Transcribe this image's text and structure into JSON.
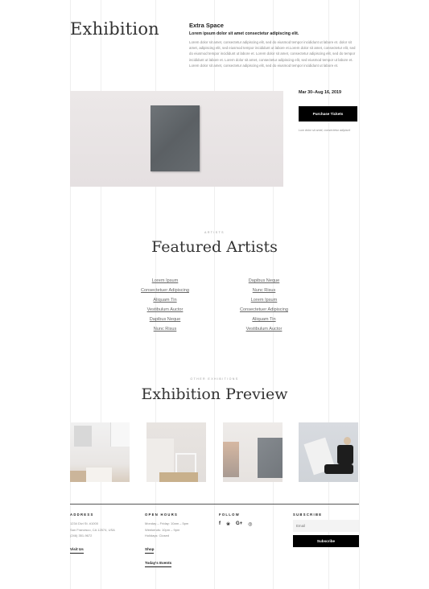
{
  "exhibition": {
    "title": "Exhibition",
    "space_name": "Extra Space",
    "subheading": "Lorem ipsum dolor sit amet consectetur adipiscing elit.",
    "paragraph": "Lorem dolor sit amet, consectetur adipiscing elit, sed do eiusmod tempor incididunt ut labore et. dolor sit amet, adipiscing elit, sed eiusmod tempor incididunt ut labore et.Lorem dolor sit amet, consectetur elit, sed do eiusmod tempor incididunt ut labore et. Lorem dolor sit amet, consectetur adipiscing elit, sed do tempor incididunt ut labore et. Lorem dolor sit amet, consectetur adipiscing elit, sed eiusmod tempor ut labore et. Lorem dolor sit amet, consectetur adipiscing elit, sed do eiusmod tempor incididunt ut labore et.",
    "date": "Mar 30–Aug 16, 2019",
    "tickets_label": "Purchase Tickets",
    "note": "Lum dolor sit amet, consectetur adipiscit"
  },
  "artists": {
    "eyebrow": "ARTISTS",
    "title": "Featured Artists",
    "left": [
      "Lorem Ipsum",
      "Consectetuer Adipiscing",
      "Aliquam Tin",
      "Vestibulum Auctor",
      "Dapibus Neque",
      "Nunc Risus"
    ],
    "right": [
      "Dapibus Neque",
      "Nunc Risus",
      "Lorem Ipsum",
      "Consectetuer Adipiscing",
      "Aliquam Tin",
      "Vestibulum Auctor"
    ]
  },
  "preview": {
    "eyebrow": "OTHER EXHIBITIONS",
    "title": "Exhibition Preview"
  },
  "footer": {
    "address_head": "ADDRESS",
    "address_lines": [
      "1234 Divi St. #1000",
      "San Francisco, CA 12574, USA",
      "(246) 351-9672"
    ],
    "visit_label": "Visit Us",
    "hours_head": "OPEN HOURS",
    "hours_lines": [
      "Monday – Friday: 10am – 5pm",
      "Weekends: 10pm – 9pm",
      "Holidays: Closed"
    ],
    "shop_label": "Shop",
    "events_label": "Today's Events",
    "follow_head": "FOLLOW",
    "social": [
      "f",
      "❀",
      "G+",
      "◎"
    ],
    "subscribe_head": "SUBSCRIBE",
    "email_placeholder": "Email",
    "subscribe_label": "Subscribe"
  }
}
